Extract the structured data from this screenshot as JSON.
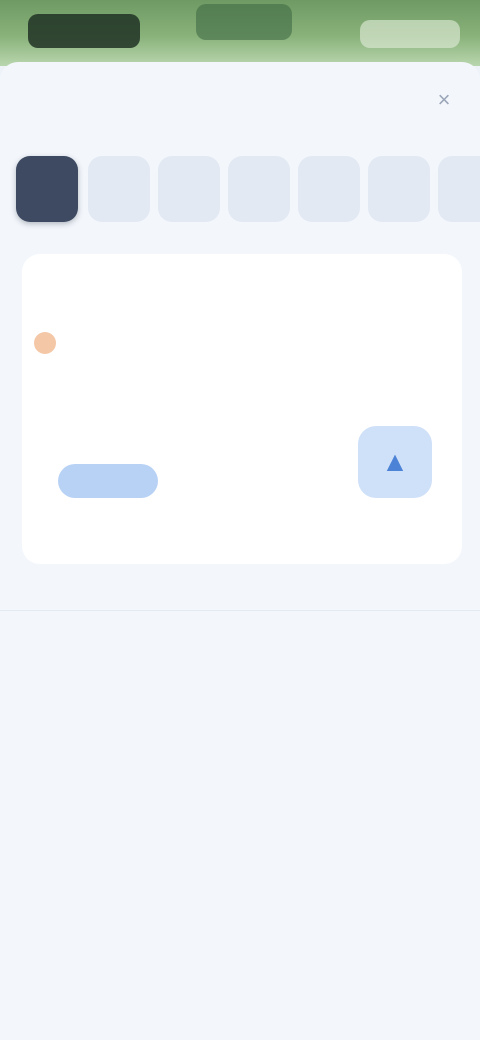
{
  "header": {
    "brand_label": "",
    "center_label": "",
    "right_label": ""
  },
  "sheet": {
    "title": "",
    "close_symbol": "×"
  },
  "thumbnails": {
    "count_visible": 7,
    "active_index": 0
  },
  "card": {
    "title": "",
    "author": "",
    "left_button": "",
    "right_button_icon": "▲"
  },
  "sections": [
    {
      "heading": "",
      "text": ""
    },
    {
      "heading": "",
      "text": ""
    },
    {
      "heading": "",
      "text": ""
    },
    {
      "heading": "",
      "text": ""
    }
  ],
  "colors": {
    "accent": "#4c83d6",
    "active_thumb": "#3d4a62",
    "header_green": "#7aa76c"
  }
}
